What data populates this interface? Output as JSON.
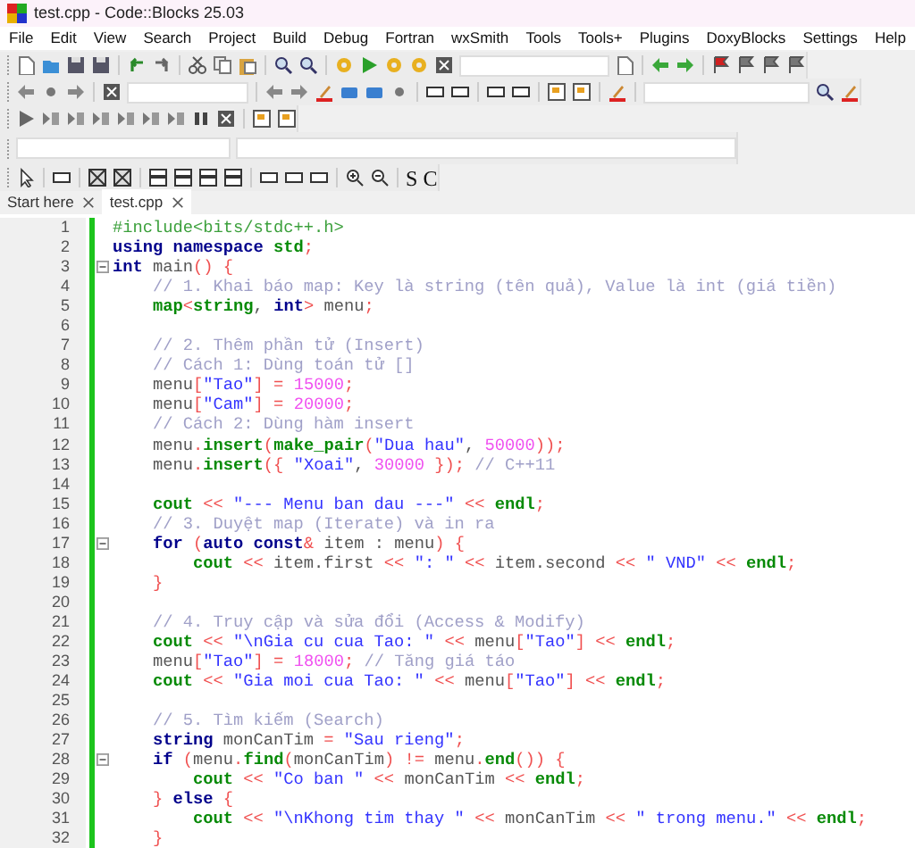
{
  "window": {
    "title": "test.cpp - Code::Blocks 25.03"
  },
  "menu": [
    "File",
    "Edit",
    "View",
    "Search",
    "Project",
    "Build",
    "Debug",
    "Fortran",
    "wxSmith",
    "Tools",
    "Tools+",
    "Plugins",
    "DoxyBlocks",
    "Settings",
    "Help"
  ],
  "wx_toolbar": {
    "letters": [
      "S",
      "C"
    ]
  },
  "tabs": [
    {
      "label": "Start here",
      "selected": false
    },
    {
      "label": "test.cpp",
      "selected": true
    }
  ],
  "lines": [
    {
      "number": "1",
      "fold": false,
      "tokens": [
        {
          "kind": "pp",
          "text": "#include<bits/stdc++.h>"
        }
      ]
    },
    {
      "number": "2",
      "fold": false,
      "tokens": [
        {
          "kind": "kw",
          "text": "using "
        },
        {
          "kind": "kw",
          "text": "namespace "
        },
        {
          "kind": "id",
          "text": "std"
        },
        {
          "kind": "op",
          "text": ";"
        }
      ]
    },
    {
      "number": "3",
      "fold": true,
      "tokens": [
        {
          "kind": "kw",
          "text": "int "
        },
        {
          "kind": "pl",
          "text": "main"
        },
        {
          "kind": "op",
          "text": "() {"
        }
      ]
    },
    {
      "number": "4",
      "fold": false,
      "tokens": [
        {
          "kind": "cm",
          "text": "    // 1. Khai báo map: Key là string (tên quả), Value là int (giá tiền)"
        }
      ]
    },
    {
      "number": "5",
      "fold": false,
      "tokens": [
        {
          "kind": "id",
          "text": "    map"
        },
        {
          "kind": "op",
          "text": "<"
        },
        {
          "kind": "id",
          "text": "string"
        },
        {
          "kind": "pl",
          "text": ", "
        },
        {
          "kind": "kw",
          "text": "int"
        },
        {
          "kind": "op",
          "text": ">"
        },
        {
          "kind": "pl",
          "text": " menu"
        },
        {
          "kind": "op",
          "text": ";"
        }
      ]
    },
    {
      "number": "6",
      "fold": false
    },
    {
      "number": "7",
      "fold": false,
      "tokens": [
        {
          "kind": "cm",
          "text": "    // 2. Thêm phần tử (Insert)"
        }
      ]
    },
    {
      "number": "8",
      "fold": false,
      "tokens": [
        {
          "kind": "cm",
          "text": "    // Cách 1: Dùng toán tử []"
        }
      ]
    },
    {
      "number": "9",
      "fold": false,
      "tokens": [
        {
          "kind": "pl",
          "text": "    menu"
        },
        {
          "kind": "op",
          "text": "["
        },
        {
          "kind": "str",
          "text": "\"Tao\""
        },
        {
          "kind": "op",
          "text": "] = "
        },
        {
          "kind": "num",
          "text": "15000"
        },
        {
          "kind": "op",
          "text": ";"
        }
      ]
    },
    {
      "number": "10",
      "fold": false,
      "tokens": [
        {
          "kind": "pl",
          "text": "    menu"
        },
        {
          "kind": "op",
          "text": "["
        },
        {
          "kind": "str",
          "text": "\"Cam\""
        },
        {
          "kind": "op",
          "text": "] = "
        },
        {
          "kind": "num",
          "text": "20000"
        },
        {
          "kind": "op",
          "text": ";"
        }
      ]
    },
    {
      "number": "11",
      "fold": false,
      "tokens": [
        {
          "kind": "cm",
          "text": "    // Cách 2: Dùng hàm insert"
        }
      ]
    },
    {
      "number": "12",
      "fold": false,
      "tokens": [
        {
          "kind": "pl",
          "text": "    menu"
        },
        {
          "kind": "op",
          "text": "."
        },
        {
          "kind": "id",
          "text": "insert"
        },
        {
          "kind": "op",
          "text": "("
        },
        {
          "kind": "id",
          "text": "make_pair"
        },
        {
          "kind": "op",
          "text": "("
        },
        {
          "kind": "str",
          "text": "\"Dua hau\""
        },
        {
          "kind": "pl",
          "text": ", "
        },
        {
          "kind": "num",
          "text": "50000"
        },
        {
          "kind": "op",
          "text": "));"
        }
      ]
    },
    {
      "number": "13",
      "fold": false,
      "tokens": [
        {
          "kind": "pl",
          "text": "    menu"
        },
        {
          "kind": "op",
          "text": "."
        },
        {
          "kind": "id",
          "text": "insert"
        },
        {
          "kind": "op",
          "text": "({ "
        },
        {
          "kind": "str",
          "text": "\"Xoai\""
        },
        {
          "kind": "pl",
          "text": ", "
        },
        {
          "kind": "num",
          "text": "30000"
        },
        {
          "kind": "op",
          "text": " }); "
        },
        {
          "kind": "cm",
          "text": "// C++11"
        }
      ]
    },
    {
      "number": "14",
      "fold": false
    },
    {
      "number": "15",
      "fold": false,
      "tokens": [
        {
          "kind": "id",
          "text": "    cout"
        },
        {
          "kind": "op",
          "text": " << "
        },
        {
          "kind": "str",
          "text": "\"--- Menu ban dau ---\""
        },
        {
          "kind": "op",
          "text": " << "
        },
        {
          "kind": "id",
          "text": "endl"
        },
        {
          "kind": "op",
          "text": ";"
        }
      ]
    },
    {
      "number": "16",
      "fold": false,
      "tokens": [
        {
          "kind": "cm",
          "text": "    // 3. Duyệt map (Iterate) và in ra"
        }
      ]
    },
    {
      "number": "17",
      "fold": true,
      "tokens": [
        {
          "kind": "kw",
          "text": "    for"
        },
        {
          "kind": "op",
          "text": " ("
        },
        {
          "kind": "kw",
          "text": "auto const"
        },
        {
          "kind": "op",
          "text": "& "
        },
        {
          "kind": "pl",
          "text": "item : menu"
        },
        {
          "kind": "op",
          "text": ") {"
        }
      ]
    },
    {
      "number": "18",
      "fold": false,
      "tokens": [
        {
          "kind": "id",
          "text": "        cout"
        },
        {
          "kind": "op",
          "text": " << "
        },
        {
          "kind": "pl",
          "text": "item.first"
        },
        {
          "kind": "op",
          "text": " << "
        },
        {
          "kind": "str",
          "text": "\": \""
        },
        {
          "kind": "op",
          "text": " << "
        },
        {
          "kind": "pl",
          "text": "item.second"
        },
        {
          "kind": "op",
          "text": " << "
        },
        {
          "kind": "str",
          "text": "\" VND\""
        },
        {
          "kind": "op",
          "text": " << "
        },
        {
          "kind": "id",
          "text": "endl"
        },
        {
          "kind": "op",
          "text": ";"
        }
      ]
    },
    {
      "number": "19",
      "fold": false,
      "tokens": [
        {
          "kind": "op",
          "text": "    }"
        }
      ]
    },
    {
      "number": "20",
      "fold": false
    },
    {
      "number": "21",
      "fold": false,
      "tokens": [
        {
          "kind": "cm",
          "text": "    // 4. Truy cập và sửa đổi (Access & Modify)"
        }
      ]
    },
    {
      "number": "22",
      "fold": false,
      "tokens": [
        {
          "kind": "id",
          "text": "    cout"
        },
        {
          "kind": "op",
          "text": " << "
        },
        {
          "kind": "str",
          "text": "\"\\nGia cu cua Tao: \""
        },
        {
          "kind": "op",
          "text": " << "
        },
        {
          "kind": "pl",
          "text": "menu"
        },
        {
          "kind": "op",
          "text": "["
        },
        {
          "kind": "str",
          "text": "\"Tao\""
        },
        {
          "kind": "op",
          "text": "] << "
        },
        {
          "kind": "id",
          "text": "endl"
        },
        {
          "kind": "op",
          "text": ";"
        }
      ]
    },
    {
      "number": "23",
      "fold": false,
      "tokens": [
        {
          "kind": "pl",
          "text": "    menu"
        },
        {
          "kind": "op",
          "text": "["
        },
        {
          "kind": "str",
          "text": "\"Tao\""
        },
        {
          "kind": "op",
          "text": "] = "
        },
        {
          "kind": "num",
          "text": "18000"
        },
        {
          "kind": "op",
          "text": "; "
        },
        {
          "kind": "cm",
          "text": "// Tăng giá táo"
        }
      ]
    },
    {
      "number": "24",
      "fold": false,
      "tokens": [
        {
          "kind": "id",
          "text": "    cout"
        },
        {
          "kind": "op",
          "text": " << "
        },
        {
          "kind": "str",
          "text": "\"Gia moi cua Tao: \""
        },
        {
          "kind": "op",
          "text": " << "
        },
        {
          "kind": "pl",
          "text": "menu"
        },
        {
          "kind": "op",
          "text": "["
        },
        {
          "kind": "str",
          "text": "\"Tao\""
        },
        {
          "kind": "op",
          "text": "] << "
        },
        {
          "kind": "id",
          "text": "endl"
        },
        {
          "kind": "op",
          "text": ";"
        }
      ]
    },
    {
      "number": "25",
      "fold": false
    },
    {
      "number": "26",
      "fold": false,
      "tokens": [
        {
          "kind": "cm",
          "text": "    // 5. Tìm kiếm (Search)"
        }
      ]
    },
    {
      "number": "27",
      "fold": false,
      "tokens": [
        {
          "kind": "kw",
          "text": "    string "
        },
        {
          "kind": "pl",
          "text": "monCanTim "
        },
        {
          "kind": "op",
          "text": "= "
        },
        {
          "kind": "str",
          "text": "\"Sau rieng\""
        },
        {
          "kind": "op",
          "text": ";"
        }
      ]
    },
    {
      "number": "28",
      "fold": true,
      "tokens": [
        {
          "kind": "kw",
          "text": "    if "
        },
        {
          "kind": "op",
          "text": "("
        },
        {
          "kind": "pl",
          "text": "menu"
        },
        {
          "kind": "op",
          "text": "."
        },
        {
          "kind": "id",
          "text": "find"
        },
        {
          "kind": "op",
          "text": "("
        },
        {
          "kind": "pl",
          "text": "monCanTim"
        },
        {
          "kind": "op",
          "text": ") != "
        },
        {
          "kind": "pl",
          "text": "menu"
        },
        {
          "kind": "op",
          "text": "."
        },
        {
          "kind": "id",
          "text": "end"
        },
        {
          "kind": "op",
          "text": "()) {"
        }
      ]
    },
    {
      "number": "29",
      "fold": false,
      "tokens": [
        {
          "kind": "id",
          "text": "        cout"
        },
        {
          "kind": "op",
          "text": " << "
        },
        {
          "kind": "str",
          "text": "\"Co ban \""
        },
        {
          "kind": "op",
          "text": " << "
        },
        {
          "kind": "pl",
          "text": "monCanTim"
        },
        {
          "kind": "op",
          "text": " << "
        },
        {
          "kind": "id",
          "text": "endl"
        },
        {
          "kind": "op",
          "text": ";"
        }
      ]
    },
    {
      "number": "30",
      "fold": false,
      "tokens": [
        {
          "kind": "op",
          "text": "    } "
        },
        {
          "kind": "kw",
          "text": "else "
        },
        {
          "kind": "op",
          "text": "{"
        }
      ]
    },
    {
      "number": "31",
      "fold": false,
      "tokens": [
        {
          "kind": "id",
          "text": "        cout"
        },
        {
          "kind": "op",
          "text": " << "
        },
        {
          "kind": "str",
          "text": "\"\\nKhong tim thay \""
        },
        {
          "kind": "op",
          "text": " << "
        },
        {
          "kind": "pl",
          "text": "monCanTim"
        },
        {
          "kind": "op",
          "text": " << "
        },
        {
          "kind": "str",
          "text": "\" trong menu.\""
        },
        {
          "kind": "op",
          "text": " << "
        },
        {
          "kind": "id",
          "text": "endl"
        },
        {
          "kind": "op",
          "text": ";"
        }
      ]
    },
    {
      "number": "32",
      "fold": false,
      "tokens": [
        {
          "kind": "op",
          "text": "    }"
        }
      ]
    }
  ]
}
